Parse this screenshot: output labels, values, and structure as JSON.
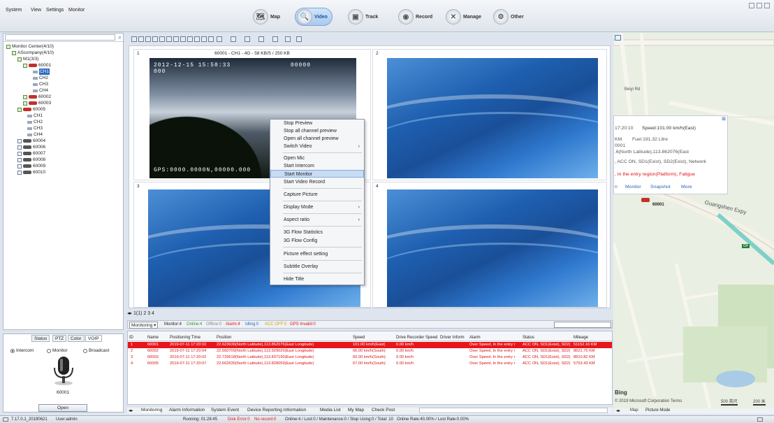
{
  "menu": {
    "items": [
      "System",
      "View",
      "Settings",
      "Monitor"
    ]
  },
  "nav": {
    "buttons": [
      "Map",
      "Video",
      "Track",
      "Record",
      "Manage",
      "Other"
    ],
    "active": "Video"
  },
  "tree": {
    "root": "Monitor Center(4/10)",
    "company": "AScompany(4/10)",
    "group": "M1(3/3)",
    "vehicles": [
      {
        "id": "60001",
        "channels": [
          "CH1",
          "CH2",
          "CH3",
          "CH4"
        ],
        "selected_channel": "CH1"
      },
      {
        "id": "60002"
      },
      {
        "id": "60003"
      },
      {
        "id": "60005",
        "channels": [
          "CH1",
          "CH2",
          "CH3",
          "CH4"
        ]
      },
      {
        "id": "60004"
      },
      {
        "id": "60006"
      },
      {
        "id": "60007"
      },
      {
        "id": "60008"
      },
      {
        "id": "60009"
      },
      {
        "id": "60010"
      }
    ]
  },
  "left_bottom": {
    "tabs": [
      "Status",
      "PTZ",
      "Color",
      "VOIP"
    ],
    "radios": [
      "Intercom",
      "Monitor",
      "Broadcast"
    ],
    "selected_radio": "Intercom",
    "mic_id": "60001",
    "open_label": "Open"
  },
  "video": {
    "cells": [
      {
        "num": "1",
        "title": "60001 - CH1 - 4G - 58 KB/S / 250 KB",
        "osd_time": "2012-12-15 15:58:33",
        "osd_id": "000",
        "osd_speed": "00000",
        "osd_gps": "GPS:0000.0000N,00000.000"
      },
      {
        "num": "2"
      },
      {
        "num": "3"
      },
      {
        "num": "4"
      }
    ],
    "page_tabs": "1(1) 2 3 4"
  },
  "context_menu": {
    "items": [
      "Stop Preview",
      "Stop all channel preview",
      "Open all channel preview",
      "Switch Video",
      "Open Mic",
      "Start Intercom",
      "Start Monitor",
      "Start Video Record",
      "Capture Picture",
      "Display Mode",
      "Aspect ratio",
      "3G Flow Statistics",
      "3G Flow Config",
      "Picture effect setting",
      "Subtitle Overlay",
      "Hide Title"
    ],
    "highlighted": "Start Monitor"
  },
  "grid_bar": {
    "mode": "Monitoring",
    "stats": [
      "Monitor:4",
      "Online:4",
      "Offline:0",
      "Alarm:4",
      "Idling:0",
      "ACC OFF:0",
      "GPS Invalid:0"
    ],
    "stat_colors": [
      "#222",
      "#1a9e2d",
      "#888",
      "#d11",
      "#1a6bd1",
      "#d7a300",
      "#d11"
    ]
  },
  "table": {
    "headers": [
      "ID",
      "Name",
      "Positioning Time",
      "Position",
      "Speed",
      "Drive Recorder Speed",
      "Driver Inform",
      "Alarm",
      "Status",
      "Mileage"
    ],
    "rows": [
      [
        "1",
        "60001",
        "2019-07-11 17:20:10",
        "22.623636(North Latitude),113.862076(East Longitude)",
        "101.00 km/h(East)",
        "0.00 km/h",
        "",
        "Over Speed, In the entry r",
        "ACC ON, SD1(Exist), SD2(",
        "51152.16 KM"
      ],
      [
        "2",
        "60002",
        "2019-07-11 17:20:04",
        "22.560709(North Latitude),113.929020(East Longitude)",
        "66.00 km/h(South)",
        "0.00 km/h",
        "",
        "Over Speed, In the entry r",
        "ACC ON, SD1(Exist), SD2(",
        "8621.75 KM"
      ],
      [
        "3",
        "60003",
        "2019-07-11 17:20:02",
        "22.729618(North Latitude),113.837190(East Longitude)",
        "60.00 km/h(South)",
        "0.00 km/h",
        "",
        "Over Speed, In the entry r",
        "ACC ON, SD1(Exist), SD2(",
        "8810.82 KM"
      ],
      [
        "4",
        "60005",
        "2019-07-11 17:20:07",
        "22.662635(North Latitude),113.828059(East Longitude)",
        "67.00 km/h(South)",
        "0.00 km/h",
        "",
        "Over Speed, In the entry r",
        "ACC ON, SD1(Exist), SD2(",
        "5753.43 KM"
      ]
    ]
  },
  "bottom_tabs": [
    "Monitoring",
    "Alarm Information",
    "System Event",
    "Device Reporting Information",
    "Media List",
    "My Map",
    "Check Post"
  ],
  "map": {
    "tabs": [
      "Map",
      "Picture Mode"
    ],
    "popup": {
      "line1": "17:20:10",
      "speed": "Speed:101.00 km/h(East)",
      "line2a": "KM",
      "fuel": "Fuel:191.32 Litre",
      "line3": "0001",
      "line4": ".6(North Latitude),113.862076(East",
      "line5": ", ACC ON, SD1(Exist), SD2(Exist), Network",
      "line6": ", In the entry region(Platform), Fatigue",
      "links": [
        "n",
        "Monitor",
        "Snapshot",
        "More"
      ]
    },
    "labels": [
      "Guangshen Expy",
      "60001",
      "G4",
      "Beiyi Rd",
      "Bing",
      "© 2019 Microsoft Corporation Terms",
      "500 英尺",
      "200 米"
    ]
  },
  "status": {
    "version": "7.17.0.1_20190621",
    "user": "User:admin",
    "running": "Running: 01:28:45",
    "disk": "Disk Error:0",
    "norecord": "No record:0",
    "online": "Online:4 / Lost:0 / Maintenance:0 / Stop Using:0 / Total: 10",
    "rate": "Online Rate:40.00% / Lost Rate:0.00%"
  }
}
